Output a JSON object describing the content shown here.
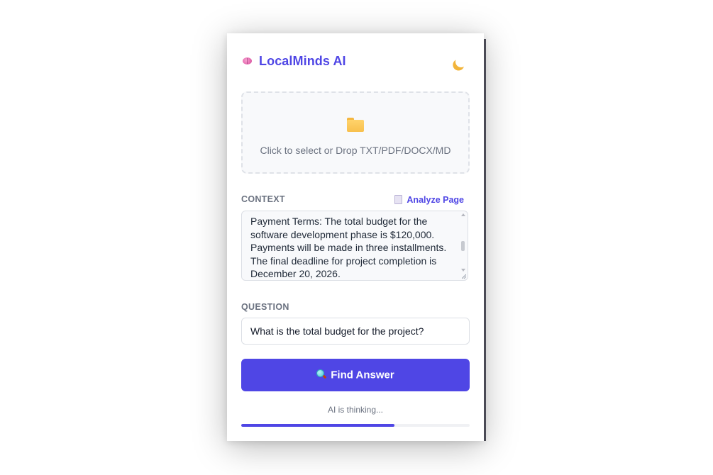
{
  "app": {
    "title": "LocalMinds AI",
    "brand_icon": "brain-icon",
    "theme_toggle_icon": "moon-icon"
  },
  "upload": {
    "icon": "folder-icon",
    "prompt": "Click to select or Drop TXT/PDF/DOCX/MD"
  },
  "context": {
    "label": "CONTEXT",
    "analyze_icon": "document-icon",
    "analyze_label": "Analyze Page",
    "text": "Payment Terms: The total budget for the software development phase is $120,000. Payments will be made in three installments. The final deadline for project completion is December 20, 2026."
  },
  "question": {
    "label": "QUESTION",
    "value": "What is the total budget for the project?"
  },
  "action": {
    "icon": "magnifier-icon",
    "label": "Find Answer"
  },
  "status": {
    "text": "AI is thinking...",
    "progress": 0.67
  },
  "colors": {
    "accent": "#4f46e5",
    "muted_text": "#6b7280",
    "dropzone_bg": "#f8f9fb"
  }
}
